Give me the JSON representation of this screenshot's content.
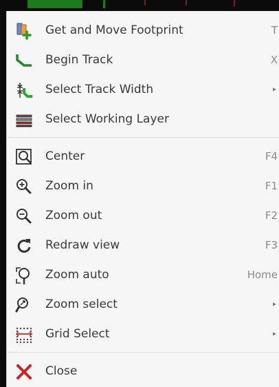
{
  "menu": {
    "items": [
      {
        "label": "Get and Move Footprint",
        "shortcut": "T",
        "icon": "footprint-move-icon"
      },
      {
        "label": "Begin Track",
        "shortcut": "X",
        "icon": "track-icon"
      },
      {
        "label": "Select Track Width",
        "submenu_arrow": "▸",
        "icon": "track-width-icon"
      },
      {
        "label": "Select Working Layer",
        "icon": "layers-icon"
      },
      {
        "label": "Center",
        "shortcut": "F4",
        "icon": "zoom-center-icon"
      },
      {
        "label": "Zoom in",
        "shortcut": "F1",
        "icon": "zoom-in-icon"
      },
      {
        "label": "Zoom out",
        "shortcut": "F2",
        "icon": "zoom-out-icon"
      },
      {
        "label": "Redraw view",
        "shortcut": "F3",
        "icon": "redraw-icon"
      },
      {
        "label": "Zoom auto",
        "shortcut": "Home",
        "icon": "zoom-auto-icon"
      },
      {
        "label": "Zoom select",
        "submenu_arrow": "▸",
        "icon": "zoom-select-icon"
      },
      {
        "label": "Grid Select",
        "submenu_arrow": "▸",
        "icon": "grid-icon"
      },
      {
        "label": "Close",
        "icon": "close-icon"
      }
    ]
  },
  "colors": {
    "menu_bg": "#f6f6f6",
    "text": "#3a3a3a",
    "shortcut": "#8a8a8a",
    "accent_green": "#2a9a2a",
    "close_red": "#d02020"
  }
}
